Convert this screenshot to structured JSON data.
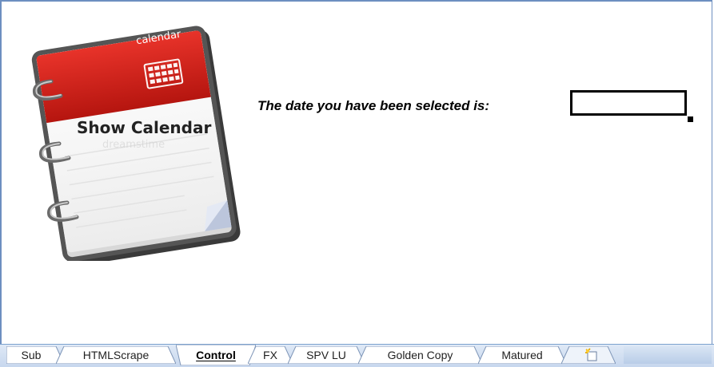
{
  "calendar_button": {
    "top_label": "calendar",
    "main_label": "Show Calendar",
    "watermark": "dreamstime"
  },
  "prompt": {
    "text": "The date you have been selected is:"
  },
  "date_cell": {
    "value": ""
  },
  "sheet_tabs": [
    {
      "label": "Sub",
      "active": false
    },
    {
      "label": "HTMLScrape",
      "active": false
    },
    {
      "label": "Control",
      "active": true
    },
    {
      "label": "FX",
      "active": false
    },
    {
      "label": "SPV LU",
      "active": false
    },
    {
      "label": "Golden Copy",
      "active": false
    },
    {
      "label": "Matured",
      "active": false
    }
  ],
  "new_sheet_tab": {
    "icon": "new-sheet-icon"
  },
  "colors": {
    "calendar_red": "#d9241c",
    "tabbar_blue": "#c7d7ee",
    "sheet_border": "#6d8fc0"
  }
}
